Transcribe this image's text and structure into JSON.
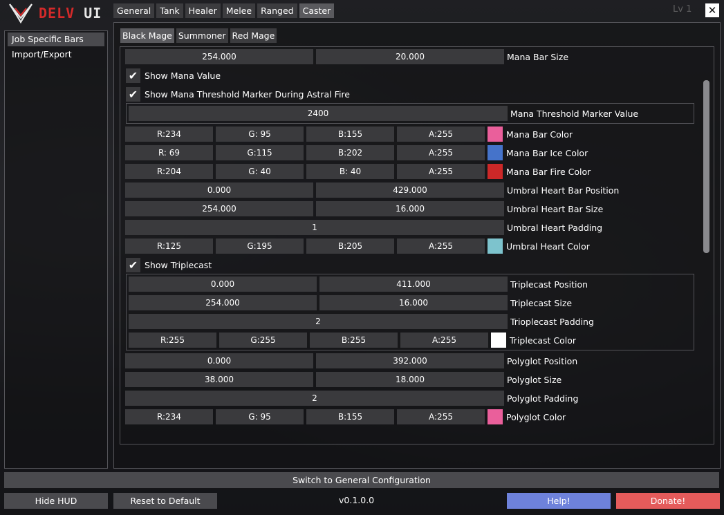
{
  "app": {
    "logo_text_left": "DELV",
    "logo_text_right": "UI",
    "level_text": "Lv 1"
  },
  "top_tabs": [
    "General",
    "Tank",
    "Healer",
    "Melee",
    "Ranged",
    "Caster"
  ],
  "sidebar": {
    "items": [
      "Job Specific Bars",
      "Import/Export"
    ]
  },
  "sub_tabs": [
    "Black Mage",
    "Summoner",
    "Red Mage"
  ],
  "settings": {
    "mana_bar_size": {
      "w": "254.000",
      "h": "20.000",
      "label": "Mana Bar Size"
    },
    "show_mana_value": {
      "label": "Show Mana Value",
      "checked": true
    },
    "show_threshold": {
      "label": "Show Mana Threshold Marker During Astral Fire",
      "checked": true
    },
    "threshold_value": {
      "value": "2400",
      "label": "Mana Threshold Marker Value"
    },
    "mana_bar_color": {
      "r": "R:234",
      "g": "G: 95",
      "b": "B:155",
      "a": "A:255",
      "label": "Mana Bar Color",
      "color": "#ea5f9b"
    },
    "mana_bar_ice_color": {
      "r": "R: 69",
      "g": "G:115",
      "b": "B:202",
      "a": "A:255",
      "label": "Mana Bar Ice Color",
      "color": "#4573ca"
    },
    "mana_bar_fire_color": {
      "r": "R:204",
      "g": "G: 40",
      "b": "B: 40",
      "a": "A:255",
      "label": "Mana Bar Fire Color",
      "color": "#cc2828"
    },
    "umbral_heart_position": {
      "x": "0.000",
      "y": "429.000",
      "label": "Umbral Heart Bar Position"
    },
    "umbral_heart_size": {
      "w": "254.000",
      "h": "16.000",
      "label": "Umbral Heart Bar Size"
    },
    "umbral_heart_padding": {
      "value": "1",
      "label": "Umbral Heart Padding"
    },
    "umbral_heart_color": {
      "r": "R:125",
      "g": "G:195",
      "b": "B:205",
      "a": "A:255",
      "label": "Umbral Heart Color",
      "color": "#7dc3cd"
    },
    "show_triplecast": {
      "label": "Show Triplecast",
      "checked": true
    },
    "triplecast_position": {
      "x": "0.000",
      "y": "411.000",
      "label": "Triplecast Position"
    },
    "triplecast_size": {
      "w": "254.000",
      "h": "16.000",
      "label": "Triplecast Size"
    },
    "triplecast_padding": {
      "value": "2",
      "label": "Trioplecast Padding"
    },
    "triplecast_color": {
      "r": "R:255",
      "g": "G:255",
      "b": "B:255",
      "a": "A:255",
      "label": "Triplecast Color",
      "color": "#ffffff"
    },
    "polyglot_position": {
      "x": "0.000",
      "y": "392.000",
      "label": "Polyglot Position"
    },
    "polyglot_size": {
      "w": "38.000",
      "h": "18.000",
      "label": "Polyglot Size"
    },
    "polyglot_padding": {
      "value": "2",
      "label": "Polyglot Padding"
    },
    "polyglot_color": {
      "r": "R:234",
      "g": "G: 95",
      "b": "B:155",
      "a": "A:255",
      "label": "Polyglot Color",
      "color": "#ea5f9b"
    }
  },
  "buttons": {
    "switch_general": "Switch to General Configuration",
    "hide_hud": "Hide HUD",
    "reset_default": "Reset to Default",
    "version": "v0.1.0.0",
    "help": "Help!",
    "donate": "Donate!"
  },
  "colors": {
    "help_bg": "#6e82db",
    "donate_bg": "#e45b5b",
    "logo_accent": "#d42a2a"
  }
}
